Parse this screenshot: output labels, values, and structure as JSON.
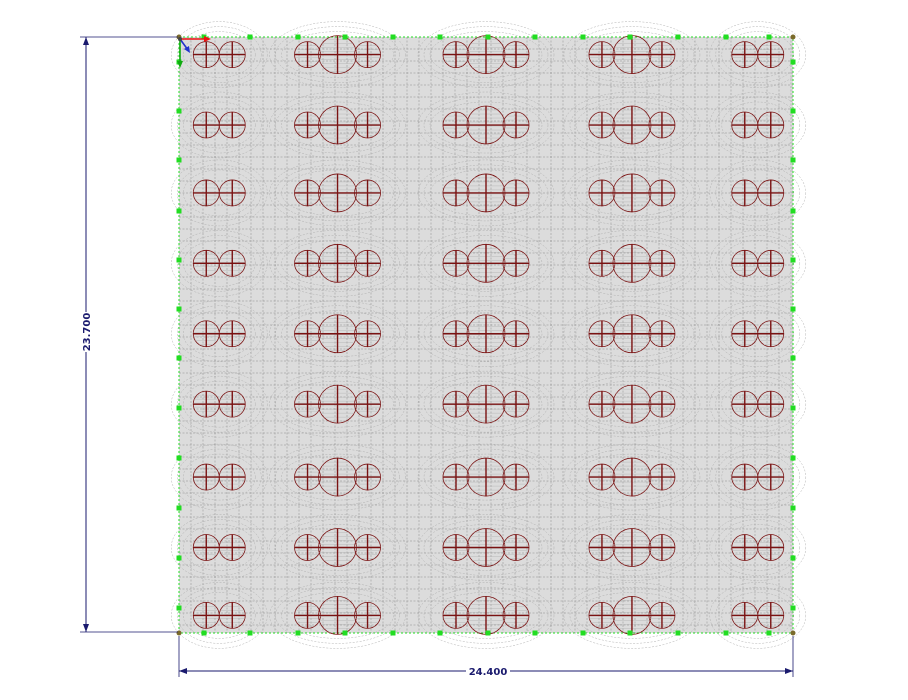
{
  "dimensions": {
    "vertical_label": "23.700",
    "horizontal_label": "24.400"
  },
  "model": {
    "width": 24.4,
    "height": 23.7,
    "column_x": [
      1.6,
      6.3,
      12.2,
      18.0,
      23.0
    ],
    "row_y": [
      0.7,
      3.5,
      6.2,
      9.0,
      11.8,
      14.6,
      17.5,
      20.3,
      23.0
    ],
    "big_column_index": [
      1,
      2,
      3
    ],
    "colors": {
      "slab_fill": "#dcdcdc",
      "mesh_line": "#8a8a8a",
      "mesh_fine": "#b0b0b0",
      "pile_circle": "#7a1212",
      "support_node": "#22dd22",
      "dimension_line": "#1a1a6e",
      "axis_x": "#ee1111",
      "axis_y": "#11aa11",
      "axis_z": "#2233cc"
    }
  },
  "icons": {
    "axis": "coordinate-axes-icon"
  }
}
